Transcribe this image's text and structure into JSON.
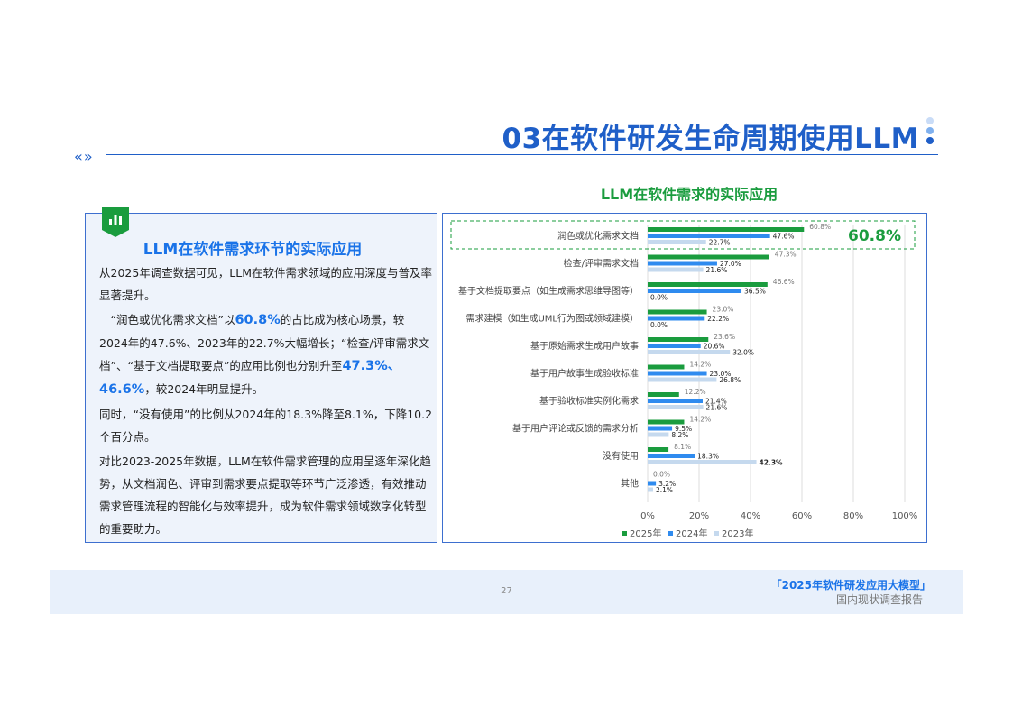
{
  "page_title": "03在软件研发生命周期使用LLM",
  "chart_heading": "LLM在软件需求的实际应用",
  "left_panel": {
    "heading": "LLM在软件需求环节的实际应用",
    "p1": "从2025年调查数据可见，LLM在软件需求领域的应用深度与普及率显著提升。",
    "p2_a": "“润色或优化需求文档”以",
    "p2_h1": "60.8%",
    "p2_b": "的占比成为核心场景，较2024年的47.6%、2023年的22.7%大幅增长；“检查/评审需求文档”、“基于文档提取要点”的应用比例也分别升至",
    "p2_h2": "47.3%",
    "p2_c": "、",
    "p2_h3": "46.6%",
    "p2_d": "，较2024年明显提升。",
    "p3": "同时，“没有使用”的比例从2024年的18.3%降至8.1%，下降10.2个百分点。",
    "p4": "对比2023-2025年数据，LLM在软件需求管理的应用呈逐年深化趋势，从文档润色、评审到需求要点提取等环节广泛渗透，有效推动需求管理流程的智能化与效率提升，成为软件需求领域数字化转型的重要助力。"
  },
  "colors": {
    "accent_blue": "#1f5fc8",
    "green": "#1a9c3e",
    "blue": "#2f8bef",
    "light_blue": "#c5d9ee"
  },
  "chart_data": {
    "type": "bar",
    "orientation": "horizontal",
    "title": "LLM在软件需求的实际应用",
    "categories": [
      "润色或优化需求文档",
      "检查/评审需求文档",
      "基于文档提取要点（如生成需求思维导图等）",
      "需求建模（如生成UML行为图或领域建模）",
      "基于原始需求生成用户故事",
      "基于用户故事生成验收标准",
      "基于验收标准实例化需求",
      "基于用户评论或反馈的需求分析",
      "没有使用",
      "其他"
    ],
    "series": [
      {
        "name": "2025年",
        "color": "#1a9c3e",
        "values": [
          60.8,
          47.3,
          46.6,
          23.0,
          23.6,
          14.2,
          12.2,
          14.2,
          8.1,
          0.0
        ]
      },
      {
        "name": "2024年",
        "color": "#2f8bef",
        "values": [
          47.6,
          27.0,
          36.5,
          22.2,
          20.6,
          23.0,
          21.4,
          9.5,
          18.3,
          3.2
        ]
      },
      {
        "name": "2023年",
        "color": "#c5d9ee",
        "values": [
          22.7,
          21.6,
          0.0,
          0.0,
          32.0,
          26.8,
          21.6,
          8.2,
          42.3,
          2.1
        ]
      }
    ],
    "value_labels": [
      [
        "60.8%",
        "47.3%",
        "46.6%",
        "23.0%",
        "23.6%",
        "14.2%",
        "12.2%",
        "14.2%",
        "8.1%",
        "0.0%"
      ],
      [
        "47.6%",
        "27.0%",
        "36.5%",
        "22.2%",
        "20.6%",
        "23.0%",
        "21.4%",
        "9.5%",
        "18.3%",
        "3.2%"
      ],
      [
        "22.7%",
        "21.6%",
        "0.0%",
        "0.0%",
        "32.0%",
        "26.8%",
        "21.6%",
        "8.2%",
        "42.3%",
        "2.1%"
      ]
    ],
    "xlim": [
      0,
      100
    ],
    "x_ticks": [
      "0%",
      "20%",
      "40%",
      "60%",
      "80%",
      "100%"
    ],
    "x_tick_values": [
      0,
      20,
      40,
      60,
      80,
      100
    ],
    "grid": true,
    "legend_position": "bottom",
    "highlight_callout": "60.8%",
    "highlight_category": "润色或优化需求文档"
  },
  "footer": {
    "page_number": "27",
    "report_title": "「2025年软件研发应用大模型」",
    "report_subtitle": "国内现状调查报告"
  }
}
